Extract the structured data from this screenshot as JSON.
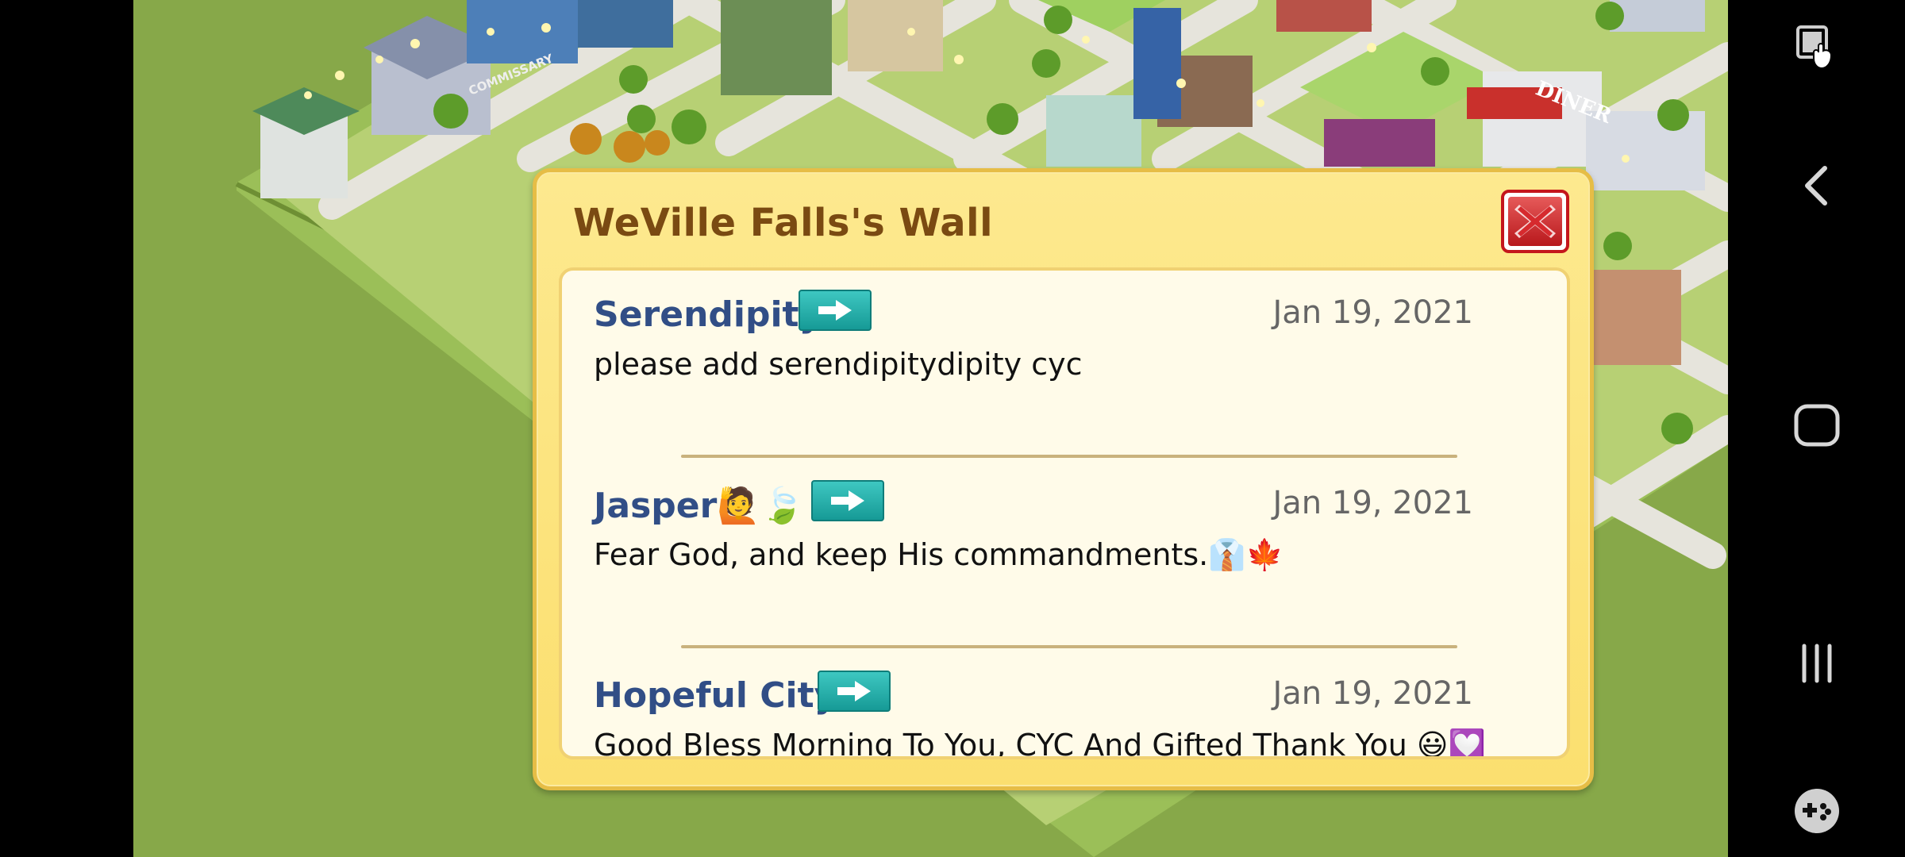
{
  "wall": {
    "title": "WeVille Falls's Wall",
    "posts": [
      {
        "name": "Serendipity",
        "date": "Jan 19, 2021",
        "message": "please add serendipitydipity cyc"
      },
      {
        "name": "Jasper🙋🍃",
        "date": "Jan 19, 2021",
        "message": "Fear God, and keep His commandments.👔🍁"
      },
      {
        "name": "Hopeful City",
        "date": "Jan 19, 2021",
        "message": "Good Bless Morning To You, CYC And Gifted Thank You 😃💟"
      }
    ]
  },
  "city_signs": {
    "commissary": "COMMISSARY",
    "diner": "DINER"
  },
  "icons": {
    "close": "close-icon",
    "go": "arrow-right-icon",
    "nav_screenshot": "screen-touch-icon",
    "nav_back": "back-icon",
    "nav_home": "home-icon",
    "nav_recents": "recents-icon",
    "nav_game": "gamepad-icon"
  },
  "colors": {
    "title": "#7a4a12",
    "name": "#314e86",
    "go_button": "#20a9a5",
    "close_border": "#c4161c",
    "dialog_bg": "#fde98f",
    "grass": "#87a849"
  }
}
